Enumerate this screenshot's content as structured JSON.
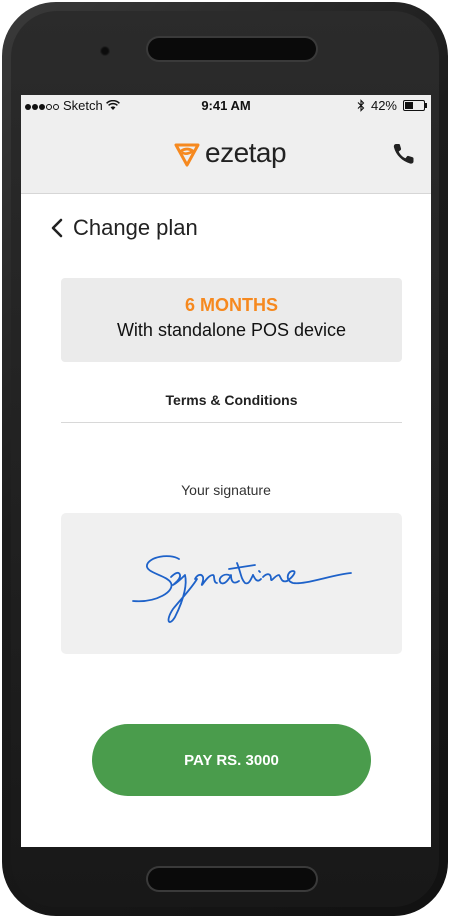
{
  "status_bar": {
    "carrier": "Sketch",
    "time": "9:41 AM",
    "battery_percent": "42%",
    "battery_level": 0.42
  },
  "header": {
    "logo_text": "ezetap",
    "logo_color": "#f6891f",
    "call_icon": "phone-icon"
  },
  "nav": {
    "back_label": "Change plan",
    "back_icon": "chevron-left-icon"
  },
  "plan": {
    "duration": "6 MONTHS",
    "description": "With standalone POS device",
    "accent": "#f6891f"
  },
  "terms_label": "Terms & Conditions",
  "signature": {
    "label": "Your signature",
    "stroke_color": "#1e62c9"
  },
  "pay_button": {
    "label": "PAY RS. 3000",
    "color": "#4a9c4c"
  }
}
